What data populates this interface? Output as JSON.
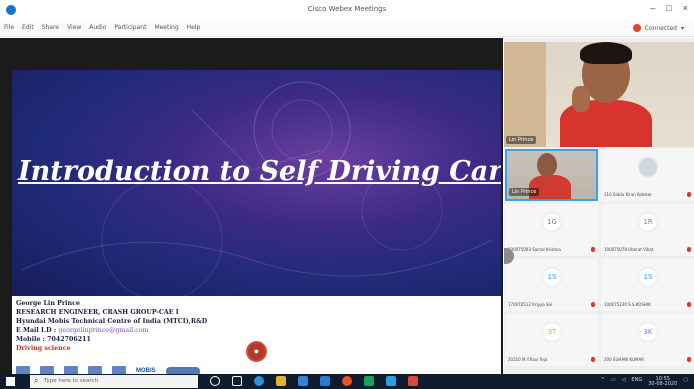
{
  "window": {
    "title": "Cisco Webex Meetings",
    "controls": [
      "–",
      "□",
      "×"
    ]
  },
  "menu": {
    "items": [
      "File",
      "Edit",
      "Share",
      "View",
      "Audio",
      "Participant",
      "Meeting",
      "Help"
    ],
    "connection_status": "Connected"
  },
  "slide": {
    "title": "Introduction to Self Driving Cars",
    "presenter_name": "George Lin Prince",
    "role": "RESEARCH ENGINEER, CRASH GROUP-CAE I",
    "org": "Hyundai Mobis Technical Centre of India (MTCI),R&D",
    "email_label": "E Mail I.D :",
    "email": "georgelinprince@gmail.com",
    "mobile": "Mobile : 7042706211",
    "department": "Driving science",
    "mobis_logo": "MOBIS"
  },
  "active_speaker": {
    "name": "Lin Prince"
  },
  "participants": [
    {
      "name": "Lin Prince",
      "initials": "",
      "kind": "video"
    },
    {
      "name": "110 Siddu Kiran Kolekar",
      "initials": "",
      "kind": "photo"
    },
    {
      "name": "100075093 Samal Krishna",
      "initials": "1G",
      "kind": "initials"
    },
    {
      "name": "100075078 Ubhrat Vihat",
      "initials": "1R",
      "kind": "initials"
    },
    {
      "name": "170070512 Kriyya Sai",
      "initials": "1S",
      "kind": "initials"
    },
    {
      "name": "100075230 S.S.KOSHIK",
      "initials": "1S",
      "kind": "initials"
    },
    {
      "name": "20210 M.Y.Ravi Teja",
      "initials": "3T",
      "kind": "initials"
    },
    {
      "name": "200 SUHANI KUMAR",
      "initials": "3K",
      "kind": "initials"
    }
  ],
  "taskbar": {
    "search_placeholder": "Type here to search",
    "time": "10:55",
    "date": "30-08-2020",
    "lang": "ENG"
  },
  "colors": {
    "accent": "#3aa0e8",
    "slide_bg": "#2b2a7e",
    "mic_muted": "#d43a2f",
    "taskbar": "#0f1c2e"
  }
}
